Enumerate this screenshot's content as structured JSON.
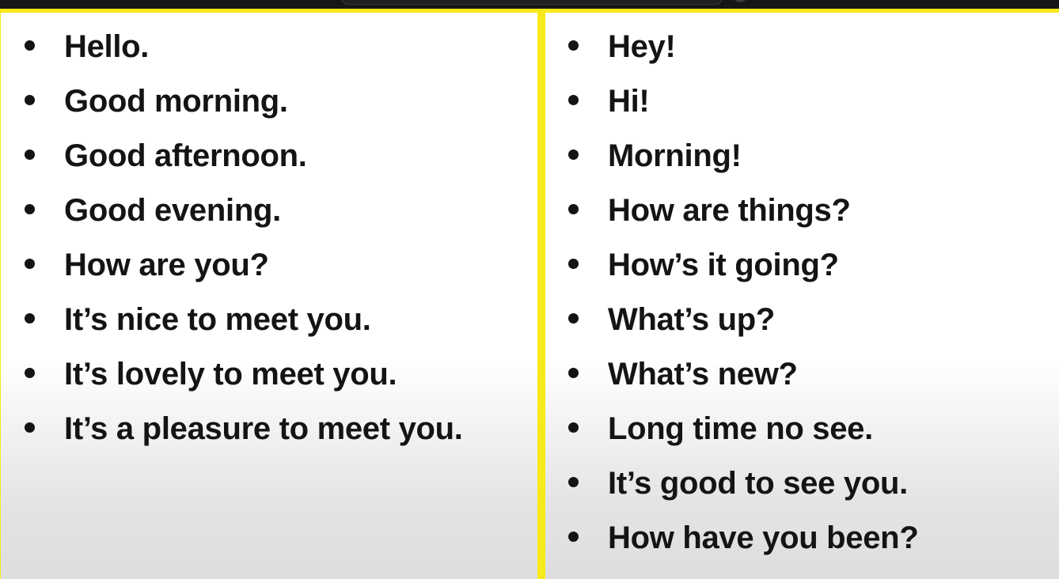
{
  "left_panel": {
    "items": [
      "Hello.",
      "Good morning.",
      "Good afternoon.",
      "Good evening.",
      "How are you?",
      "It’s nice to meet you.",
      "It’s lovely to meet you.",
      "It’s a pleasure to meet you."
    ]
  },
  "right_panel": {
    "items": [
      "Hey!",
      "Hi!",
      "Morning!",
      "How are things?",
      "How’s it going?",
      "What’s up?",
      "What’s new?",
      "Long time no see.",
      "It’s good to see you.",
      "How have you been?"
    ]
  },
  "colors": {
    "border": "#f7ea1a",
    "text": "#141414",
    "background": "#ffffff"
  }
}
